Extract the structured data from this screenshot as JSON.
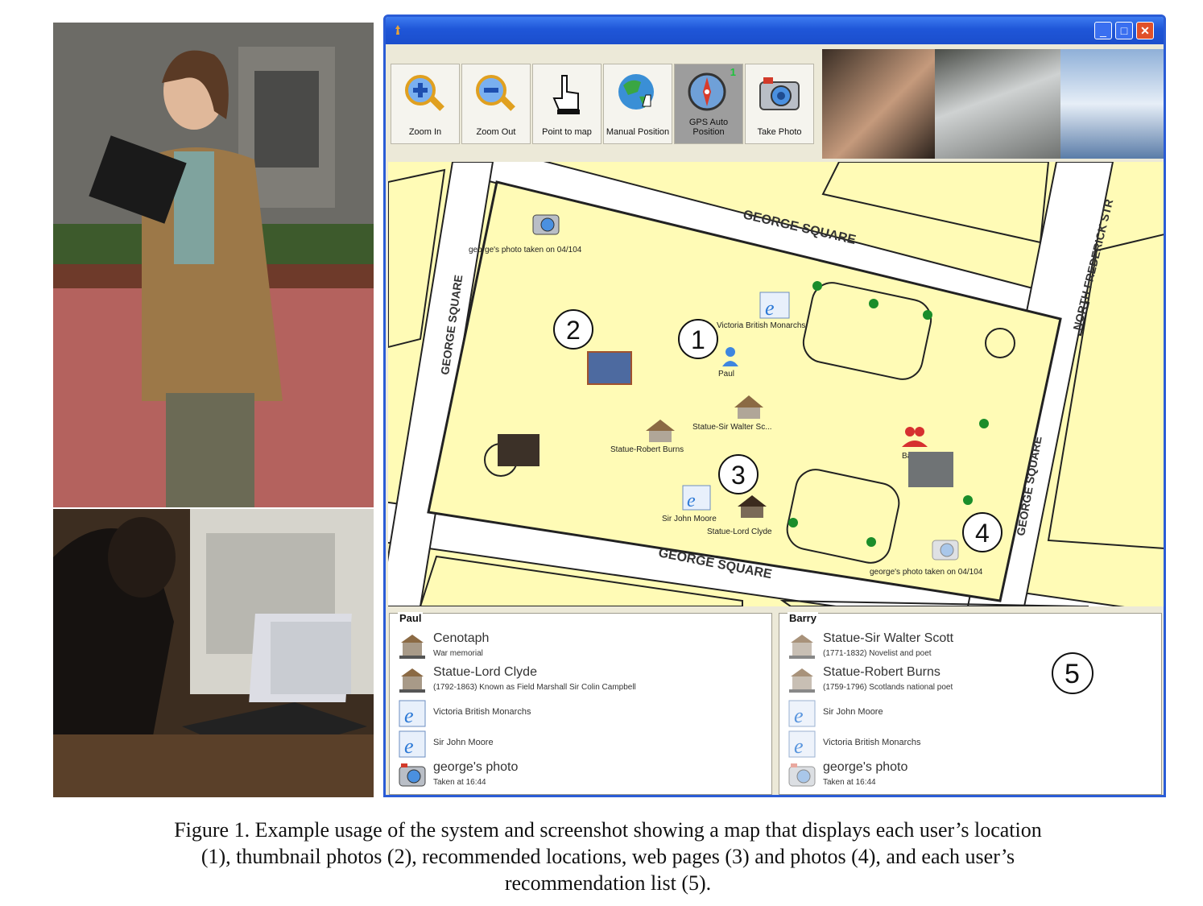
{
  "window": {
    "buttons": {
      "minimize": "_",
      "maximize": "□",
      "close": "✕"
    }
  },
  "toolbar": {
    "zoom_in": "Zoom In",
    "zoom_out": "Zoom Out",
    "point_to_map": "Point to map",
    "manual_position": "Manual Position",
    "gps_auto_position": "GPS Auto Position",
    "gps_badge": "1",
    "take_photo": "Take Photo"
  },
  "map": {
    "streets": {
      "top": "GEORGE SQUARE",
      "left": "GEORGE SQUARE",
      "bottom": "GEORGE SQUARE",
      "right": "GEORGE SQUARE",
      "north_frederick": "NORTH FREDERICK STR"
    },
    "labels": {
      "photo_top": "george's photo taken on 04/104",
      "victoria": "Victoria British Monarchs",
      "paul": "Paul",
      "walter_scott": "Statue-Sir Walter Sc...",
      "robert_burns": "Statue-Robert Burns",
      "john_moore": "Sir John Moore",
      "lord_clyde": "Statue-Lord Clyde",
      "barry": "Barry",
      "photo_bottom": "george's photo taken on 04/104"
    },
    "markers": {
      "m1": "1",
      "m2": "2",
      "m3": "3",
      "m4": "4"
    }
  },
  "panels": {
    "paul": {
      "title": "Paul",
      "items": [
        {
          "title": "Cenotaph",
          "subtitle": "War memorial",
          "icon": "statue-icon"
        },
        {
          "title": "Statue-Lord Clyde",
          "subtitle": "(1792-1863) Known as Field Marshall Sir Colin Campbell",
          "icon": "statue-icon"
        },
        {
          "title": "Victoria British Monarchs",
          "icon": "web-page-icon"
        },
        {
          "title": "Sir John Moore",
          "icon": "web-page-icon"
        },
        {
          "title": "george's photo",
          "subtitle": "Taken at 16:44",
          "icon": "camera-icon"
        }
      ]
    },
    "barry": {
      "title": "Barry",
      "marker": "5",
      "items": [
        {
          "title": "Statue-Sir Walter Scott",
          "subtitle": "(1771-1832) Novelist and poet",
          "icon": "statue-icon"
        },
        {
          "title": "Statue-Robert Burns",
          "subtitle": "(1759-1796) Scotlands national poet",
          "icon": "statue-icon"
        },
        {
          "title": "Sir John Moore",
          "icon": "web-page-icon"
        },
        {
          "title": "Victoria British Monarchs",
          "icon": "web-page-icon"
        },
        {
          "title": "george's photo",
          "subtitle": "Taken at 16:44",
          "icon": "camera-icon"
        }
      ]
    }
  },
  "caption": {
    "line1": "Figure 1. Example usage of the system and screenshot showing a map that displays each user’s location",
    "line2": "(1), thumbnail photos (2), recommended locations, web pages (3) and photos (4), and each user’s",
    "line3": "recommendation list (5)."
  }
}
